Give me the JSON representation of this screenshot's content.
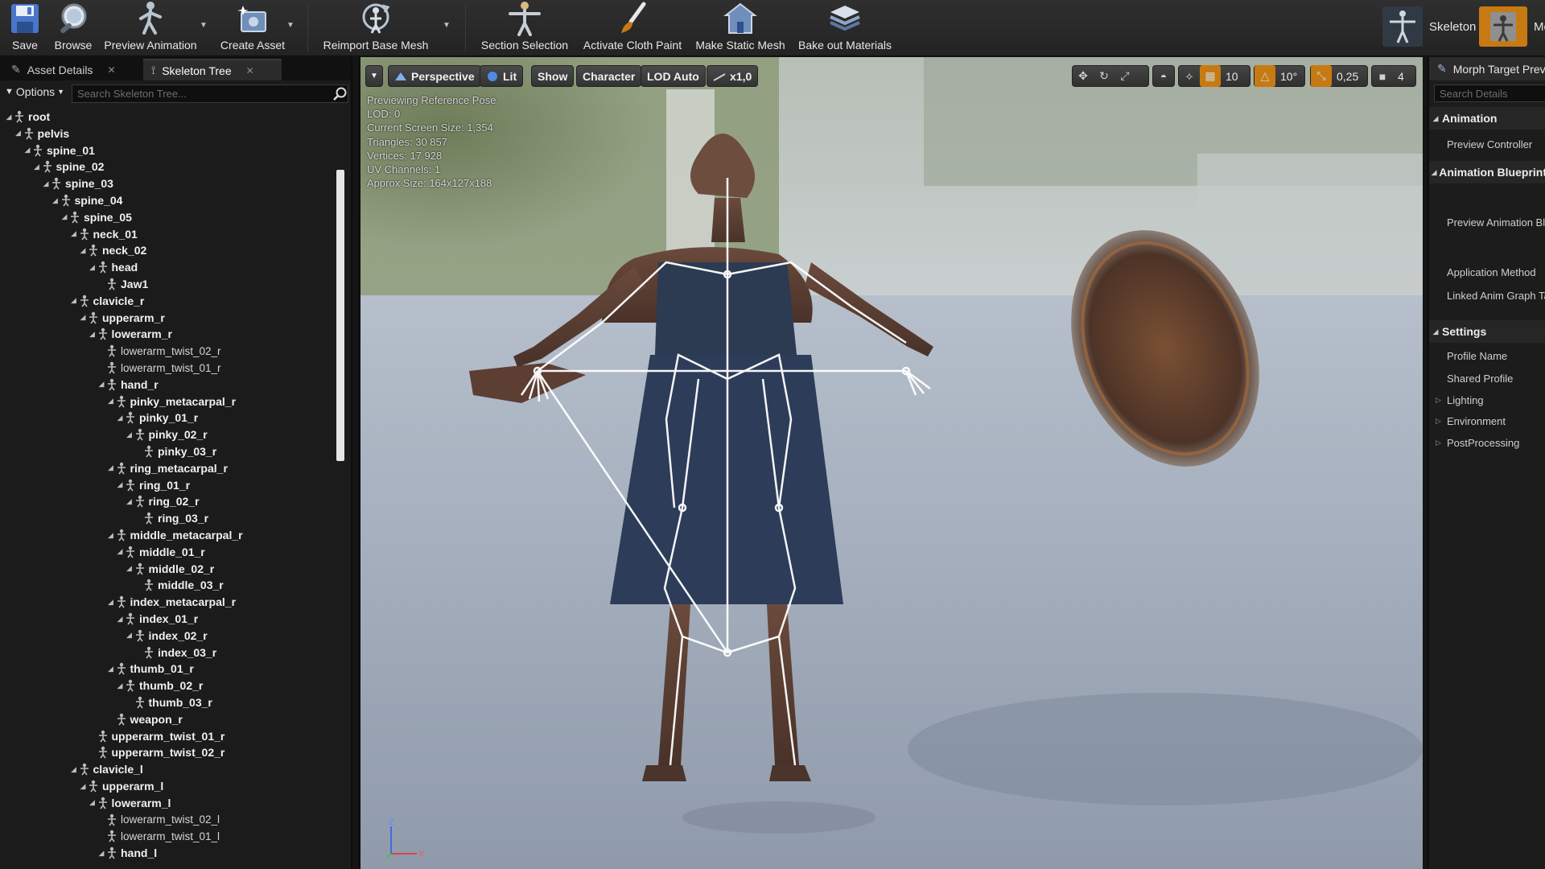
{
  "toolbar": {
    "save": "Save",
    "browse": "Browse",
    "preview_animation": "Preview Animation",
    "create_asset": "Create Asset",
    "reimport_base_mesh": "Reimport Base Mesh",
    "section_selection": "Section Selection",
    "activate_cloth_paint": "Activate Cloth Paint",
    "make_static_mesh": "Make Static Mesh",
    "bake_out_materials": "Bake out Materials",
    "mode_skeleton": "Skeleton",
    "mode_mesh": "Mesh"
  },
  "left_panel": {
    "tab_asset_details": "Asset Details",
    "tab_skeleton_tree": "Skeleton Tree",
    "options": "Options",
    "search_placeholder": "Search Skeleton Tree...",
    "bones": [
      {
        "name": "root",
        "depth": 0,
        "expanded": true,
        "leaf": false
      },
      {
        "name": "pelvis",
        "depth": 1,
        "expanded": true,
        "leaf": false
      },
      {
        "name": "spine_01",
        "depth": 2,
        "expanded": true,
        "leaf": false
      },
      {
        "name": "spine_02",
        "depth": 3,
        "expanded": true,
        "leaf": false
      },
      {
        "name": "spine_03",
        "depth": 4,
        "expanded": true,
        "leaf": false
      },
      {
        "name": "spine_04",
        "depth": 5,
        "expanded": true,
        "leaf": false
      },
      {
        "name": "spine_05",
        "depth": 6,
        "expanded": true,
        "leaf": false
      },
      {
        "name": "neck_01",
        "depth": 7,
        "expanded": true,
        "leaf": false
      },
      {
        "name": "neck_02",
        "depth": 8,
        "expanded": true,
        "leaf": false
      },
      {
        "name": "head",
        "depth": 9,
        "expanded": true,
        "leaf": false
      },
      {
        "name": "Jaw1",
        "depth": 10,
        "expanded": false,
        "leaf": false
      },
      {
        "name": "clavicle_r",
        "depth": 7,
        "expanded": true,
        "leaf": false
      },
      {
        "name": "upperarm_r",
        "depth": 8,
        "expanded": true,
        "leaf": false
      },
      {
        "name": "lowerarm_r",
        "depth": 9,
        "expanded": true,
        "leaf": false
      },
      {
        "name": "lowerarm_twist_02_r",
        "depth": 10,
        "expanded": false,
        "leaf": true
      },
      {
        "name": "lowerarm_twist_01_r",
        "depth": 10,
        "expanded": false,
        "leaf": true
      },
      {
        "name": "hand_r",
        "depth": 10,
        "expanded": true,
        "leaf": false
      },
      {
        "name": "pinky_metacarpal_r",
        "depth": 11,
        "expanded": true,
        "leaf": false
      },
      {
        "name": "pinky_01_r",
        "depth": 12,
        "expanded": true,
        "leaf": false
      },
      {
        "name": "pinky_02_r",
        "depth": 13,
        "expanded": true,
        "leaf": false
      },
      {
        "name": "pinky_03_r",
        "depth": 14,
        "expanded": false,
        "leaf": false
      },
      {
        "name": "ring_metacarpal_r",
        "depth": 11,
        "expanded": true,
        "leaf": false
      },
      {
        "name": "ring_01_r",
        "depth": 12,
        "expanded": true,
        "leaf": false
      },
      {
        "name": "ring_02_r",
        "depth": 13,
        "expanded": true,
        "leaf": false
      },
      {
        "name": "ring_03_r",
        "depth": 14,
        "expanded": false,
        "leaf": false
      },
      {
        "name": "middle_metacarpal_r",
        "depth": 11,
        "expanded": true,
        "leaf": false
      },
      {
        "name": "middle_01_r",
        "depth": 12,
        "expanded": true,
        "leaf": false
      },
      {
        "name": "middle_02_r",
        "depth": 13,
        "expanded": true,
        "leaf": false
      },
      {
        "name": "middle_03_r",
        "depth": 14,
        "expanded": false,
        "leaf": false
      },
      {
        "name": "index_metacarpal_r",
        "depth": 11,
        "expanded": true,
        "leaf": false
      },
      {
        "name": "index_01_r",
        "depth": 12,
        "expanded": true,
        "leaf": false
      },
      {
        "name": "index_02_r",
        "depth": 13,
        "expanded": true,
        "leaf": false
      },
      {
        "name": "index_03_r",
        "depth": 14,
        "expanded": false,
        "leaf": false
      },
      {
        "name": "thumb_01_r",
        "depth": 11,
        "expanded": true,
        "leaf": false
      },
      {
        "name": "thumb_02_r",
        "depth": 12,
        "expanded": true,
        "leaf": false
      },
      {
        "name": "thumb_03_r",
        "depth": 13,
        "expanded": false,
        "leaf": false
      },
      {
        "name": "weapon_r",
        "depth": 11,
        "expanded": false,
        "leaf": false
      },
      {
        "name": "upperarm_twist_01_r",
        "depth": 9,
        "expanded": false,
        "leaf": false
      },
      {
        "name": "upperarm_twist_02_r",
        "depth": 9,
        "expanded": false,
        "leaf": false
      },
      {
        "name": "clavicle_l",
        "depth": 7,
        "expanded": true,
        "leaf": false
      },
      {
        "name": "upperarm_l",
        "depth": 8,
        "expanded": true,
        "leaf": false
      },
      {
        "name": "lowerarm_l",
        "depth": 9,
        "expanded": true,
        "leaf": false
      },
      {
        "name": "lowerarm_twist_02_l",
        "depth": 10,
        "expanded": false,
        "leaf": true
      },
      {
        "name": "lowerarm_twist_01_l",
        "depth": 10,
        "expanded": false,
        "leaf": true
      },
      {
        "name": "hand_l",
        "depth": 10,
        "expanded": true,
        "leaf": false
      }
    ]
  },
  "viewport": {
    "buttons": {
      "perspective": "Perspective",
      "lit": "Lit",
      "show": "Show",
      "character": "Character",
      "lod": "LOD Auto",
      "speed": "x1,0"
    },
    "grid_snap": "10",
    "rotation_snap": "10°",
    "scale_snap": "0,25",
    "camera_speed": "4",
    "stats": [
      "Previewing Reference Pose",
      "LOD: 0",
      "Current Screen Size: 1,354",
      "Triangles: 30 857",
      "Vertices: 17 928",
      "UV Channels: 1",
      "Approx Size: 164x127x188"
    ],
    "axis_z": "Z",
    "axis_x": "X"
  },
  "right_panel": {
    "tab": "Morph Target Preview",
    "search_placeholder": "Search Details",
    "animation_category": "Animation",
    "preview_controller": "Preview Controller",
    "anim_blueprint_category": "Animation Blueprint",
    "preview_animation_bp": "Preview Animation Blueprint",
    "application_method": "Application Method",
    "linked_anim_graph": "Linked Anim Graph Tag",
    "settings_category": "Settings",
    "profile_name": "Profile Name",
    "shared_profile": "Shared Profile",
    "lighting": "Lighting",
    "environment": "Environment",
    "post_processing": "PostProcessing"
  },
  "colors": {
    "accent_orange": "#c77a12",
    "panel_bg": "#1b1b1b",
    "toolbar_bg": "#2a2a2a"
  }
}
